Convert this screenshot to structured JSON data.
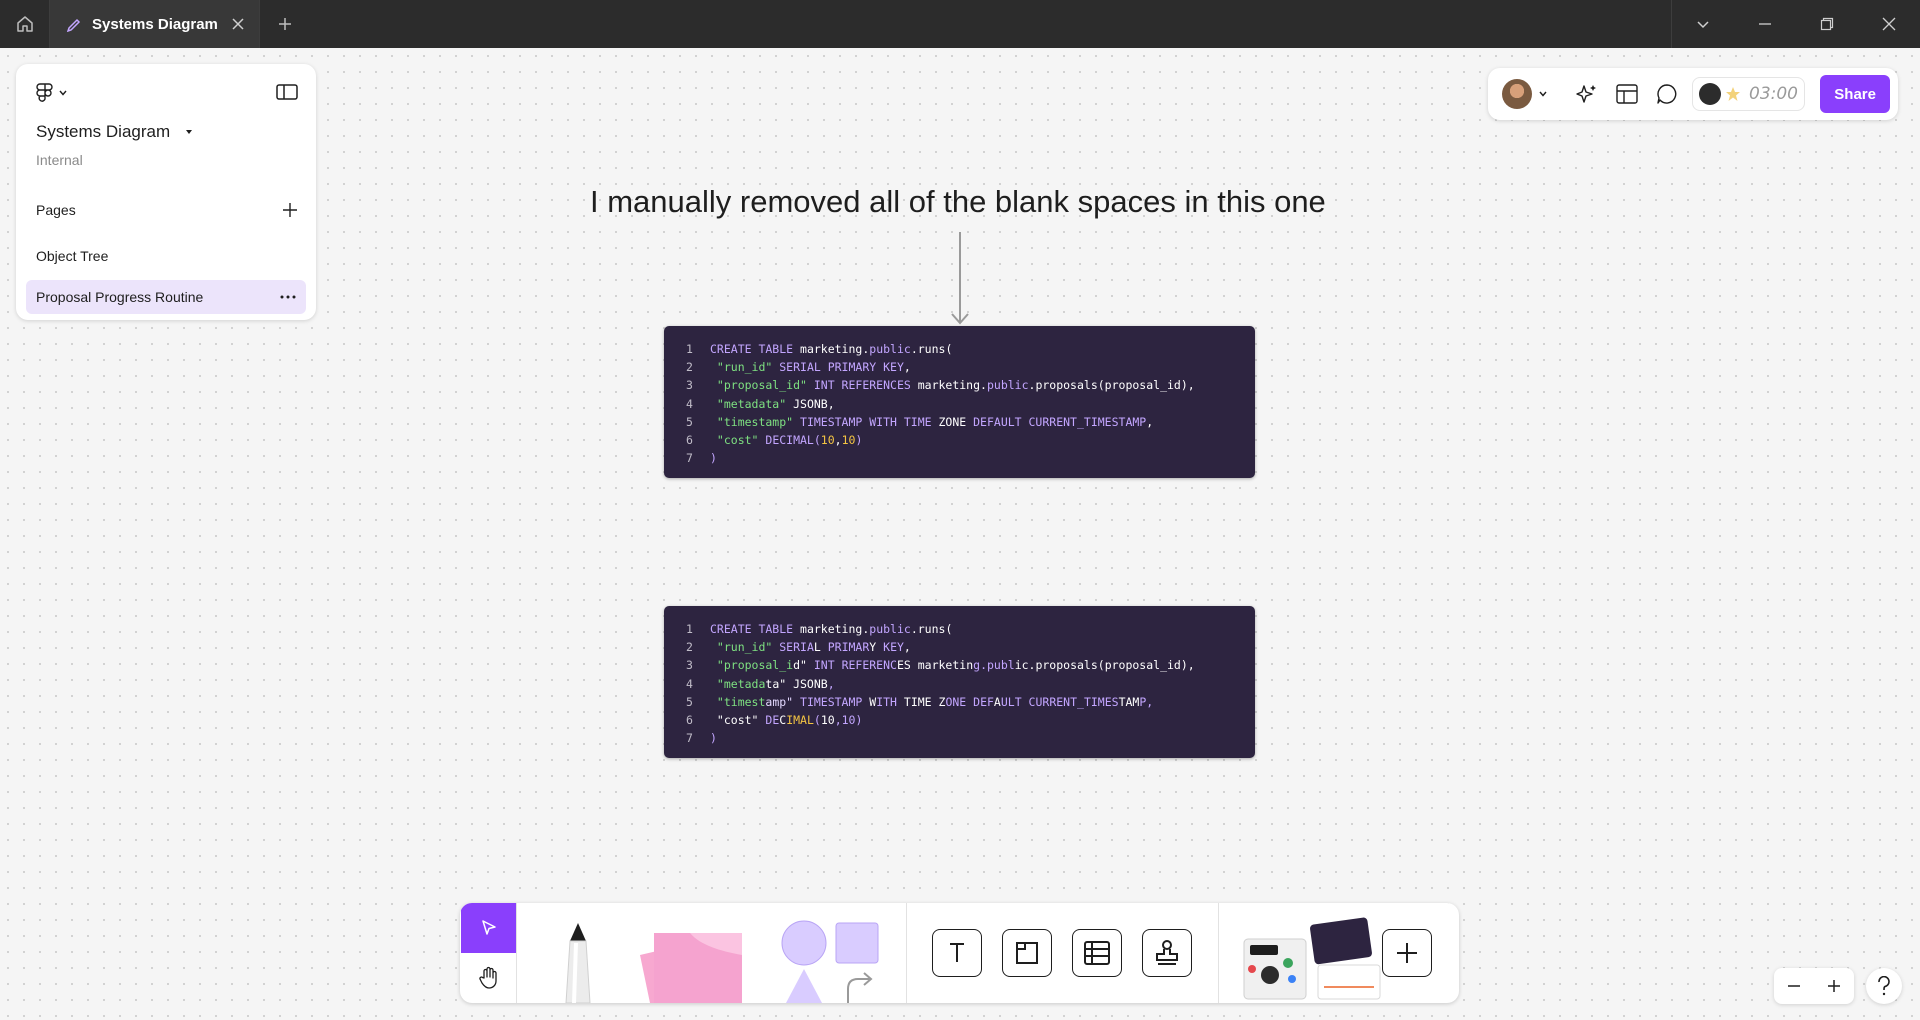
{
  "titlebar": {
    "tab_label": "Systems Diagram"
  },
  "left_panel": {
    "file_name": "Systems Diagram",
    "team": "Internal",
    "pages_label": "Pages",
    "pages": [
      "Object Tree",
      "Proposal Progress Routine"
    ]
  },
  "toolbar_right": {
    "timer": "03:00",
    "share_label": "Share"
  },
  "canvas": {
    "heading": "I manually removed all of the blank spaces in this one"
  },
  "code_blocks": [
    {
      "lines": [
        {
          "num": "1",
          "tokens": [
            [
              "kw",
              "CREATE TABLE "
            ],
            [
              "id",
              "marketing."
            ],
            [
              "kw",
              "public"
            ],
            [
              "id",
              "."
            ],
            [
              "id",
              "runs("
            ]
          ]
        },
        {
          "num": "2",
          "tokens": [
            [
              "str",
              " \"run_id\" "
            ],
            [
              "kw",
              "SERIAL PRIMARY KEY"
            ],
            [
              "id",
              ","
            ]
          ]
        },
        {
          "num": "3",
          "tokens": [
            [
              "str",
              " \"proposal_id\" "
            ],
            [
              "kw",
              "INT REFERENCES "
            ],
            [
              "id",
              "marketing."
            ],
            [
              "kw",
              "public"
            ],
            [
              "id",
              ".proposals(proposal_id),"
            ]
          ]
        },
        {
          "num": "4",
          "tokens": [
            [
              "str",
              " \"metadata\" "
            ],
            [
              "id",
              "JSONB,"
            ]
          ]
        },
        {
          "num": "5",
          "tokens": [
            [
              "str",
              " \"timestamp\" "
            ],
            [
              "kw",
              "TIMESTAMP WITH TIME "
            ],
            [
              "id",
              "ZONE "
            ],
            [
              "kw",
              "DEFAULT CURRENT_TIMESTAMP"
            ],
            [
              "id",
              ","
            ]
          ]
        },
        {
          "num": "6",
          "tokens": [
            [
              "str",
              " \"cost\" "
            ],
            [
              "kw",
              "DECIMAL("
            ],
            [
              "num",
              "10"
            ],
            [
              "id",
              ","
            ],
            [
              "num",
              "10"
            ],
            [
              "kw",
              ")"
            ]
          ]
        },
        {
          "num": "7",
          "tokens": [
            [
              "kw",
              ")"
            ]
          ]
        }
      ]
    },
    {
      "lines": [
        {
          "num": "1",
          "tokens": [
            [
              "kw",
              "CREATE TABLE "
            ],
            [
              "id",
              "marketing."
            ],
            [
              "kw",
              "public"
            ],
            [
              "id",
              "."
            ],
            [
              "id",
              "runs("
            ]
          ]
        },
        {
          "num": "2",
          "tokens": [
            [
              "str",
              " \"run_id\" "
            ],
            [
              "kw",
              "SERIA"
            ],
            [
              "id",
              "L "
            ],
            [
              "kw",
              "PRIMAR"
            ],
            [
              "id",
              "Y "
            ],
            [
              "kw",
              "KEY"
            ],
            [
              "id",
              ","
            ]
          ]
        },
        {
          "num": "3",
          "tokens": [
            [
              "str",
              " \"proposal_i"
            ],
            [
              "id",
              "d\" "
            ],
            [
              "kw",
              "INT REFERENC"
            ],
            [
              "id",
              "ES marketin"
            ],
            [
              "kw",
              "g.publ"
            ],
            [
              "id",
              "ic.proposals(proposal_id),"
            ]
          ]
        },
        {
          "num": "4",
          "tokens": [
            [
              "str",
              " \"metada"
            ],
            [
              "id",
              "ta\" JSONB"
            ],
            [
              "kw",
              ","
            ]
          ]
        },
        {
          "num": "5",
          "tokens": [
            [
              "str",
              " \"timest"
            ],
            [
              "mx",
              "amp\" "
            ],
            [
              "kw",
              "TIMESTAMP "
            ],
            [
              "id",
              "W"
            ],
            [
              "kw",
              "ITH "
            ],
            [
              "id",
              "TIME Z"
            ],
            [
              "kw",
              "ONE DEF"
            ],
            [
              "id",
              "A"
            ],
            [
              "kw",
              "ULT CURRENT_TIMES"
            ],
            [
              "id",
              "TAM"
            ],
            [
              "kw",
              "P,"
            ]
          ]
        },
        {
          "num": "6",
          "tokens": [
            [
              "id",
              " \"cost\" "
            ],
            [
              "kw",
              "DE"
            ],
            [
              "id",
              "C"
            ],
            [
              "num",
              "IMAL"
            ],
            [
              "kw",
              "("
            ],
            [
              "id",
              "10"
            ],
            [
              "kw",
              ",10)"
            ]
          ]
        },
        {
          "num": "7",
          "tokens": [
            [
              "kw",
              ")"
            ]
          ]
        }
      ]
    }
  ],
  "colors": {
    "accent": "#8a3ffc",
    "code_bg": "#2d2440",
    "active_page_bg": "#ece4fb"
  }
}
